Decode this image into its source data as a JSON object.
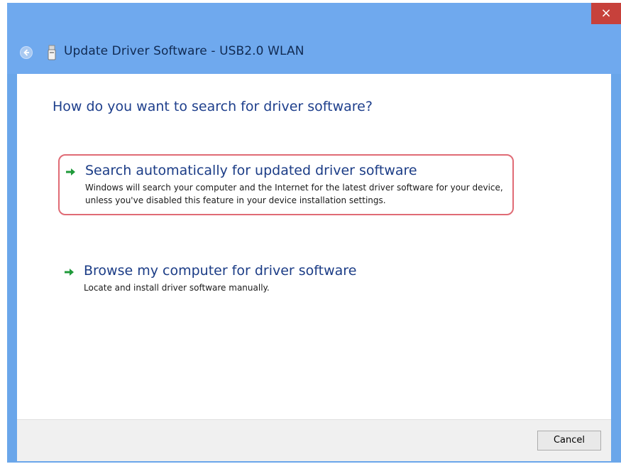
{
  "window": {
    "title": "Update Driver Software - USB2.0 WLAN",
    "close_label": "×"
  },
  "content": {
    "question": "How do you want to search for driver software?",
    "options": [
      {
        "title": "Search automatically for updated driver software",
        "description": "Windows will search your computer and the Internet for the latest driver software for your device, unless you've disabled this feature in your device installation settings.",
        "highlighted": true
      },
      {
        "title": "Browse my computer for driver software",
        "description": "Locate and install driver software manually.",
        "highlighted": false
      }
    ]
  },
  "footer": {
    "cancel_label": "Cancel"
  },
  "colors": {
    "titlebar": "#6fa9ee",
    "close": "#c7413b",
    "link_blue": "#1b3c86",
    "highlight_border": "#e06b75",
    "arrow_green": "#1f9a3a"
  },
  "icons": {
    "back": "back-arrow-icon",
    "device": "usb-device-icon",
    "option_arrow": "green-arrow-icon",
    "close": "close-icon"
  }
}
